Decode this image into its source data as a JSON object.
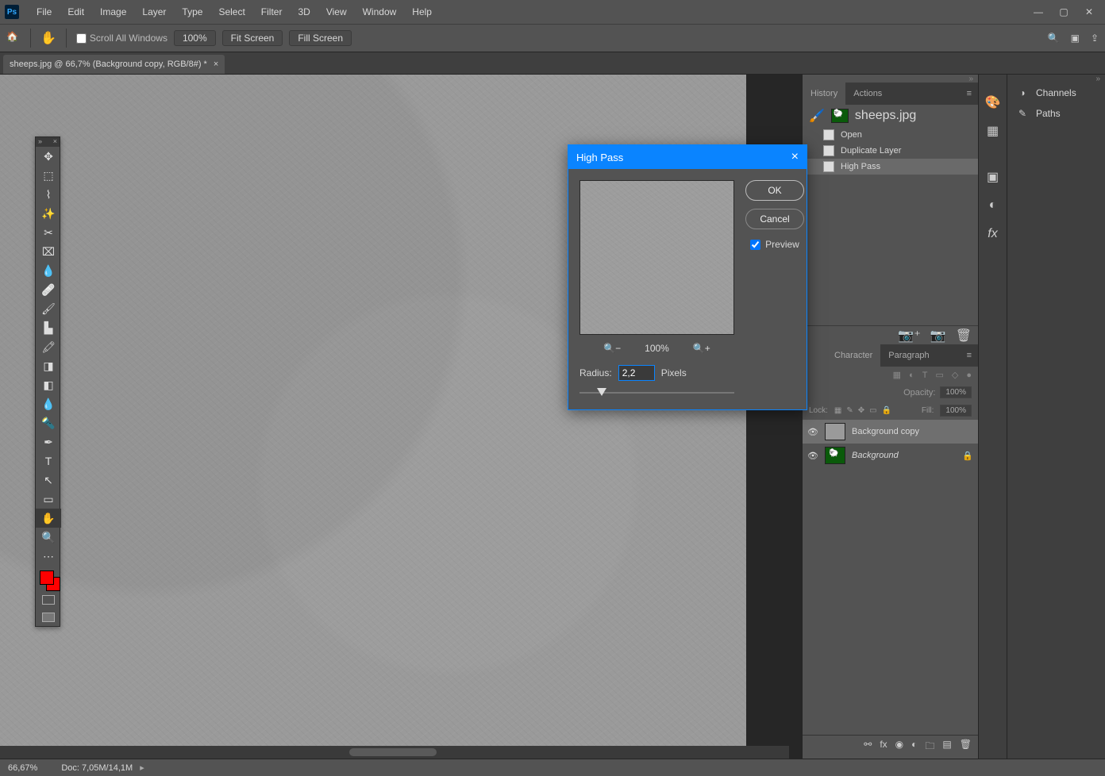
{
  "menubar": {
    "items": [
      "File",
      "Edit",
      "Image",
      "Layer",
      "Type",
      "Select",
      "Filter",
      "3D",
      "View",
      "Window",
      "Help"
    ]
  },
  "optionbar": {
    "scroll_all": "Scroll All Windows",
    "zoom_pct": "100%",
    "fit_screen": "Fit Screen",
    "fill_screen": "Fill Screen"
  },
  "tab": {
    "title": "sheeps.jpg @ 66,7% (Background copy, RGB/8#) *"
  },
  "panels": {
    "history_tab": "History",
    "actions_tab": "Actions",
    "source_name": "sheeps.jpg",
    "steps": [
      "Open",
      "Duplicate Layer",
      "High Pass"
    ],
    "character_tab": "Character",
    "paragraph_tab": "Paragraph",
    "opacity_label": "Opacity:",
    "opacity_val": "100%",
    "lock_label": "Lock:",
    "fill_label": "Fill:",
    "fill_val": "100%",
    "layers": [
      {
        "name": "Background copy",
        "locked": false
      },
      {
        "name": "Background",
        "locked": true
      }
    ],
    "channels": "Channels",
    "paths": "Paths"
  },
  "dialog": {
    "title": "High Pass",
    "ok": "OK",
    "cancel": "Cancel",
    "preview": "Preview",
    "zoom": "100%",
    "radius_label": "Radius:",
    "radius_value": "2,2",
    "pixels": "Pixels"
  },
  "statusbar": {
    "zoom": "66,67%",
    "doc": "Doc: 7,05M/14,1M"
  }
}
